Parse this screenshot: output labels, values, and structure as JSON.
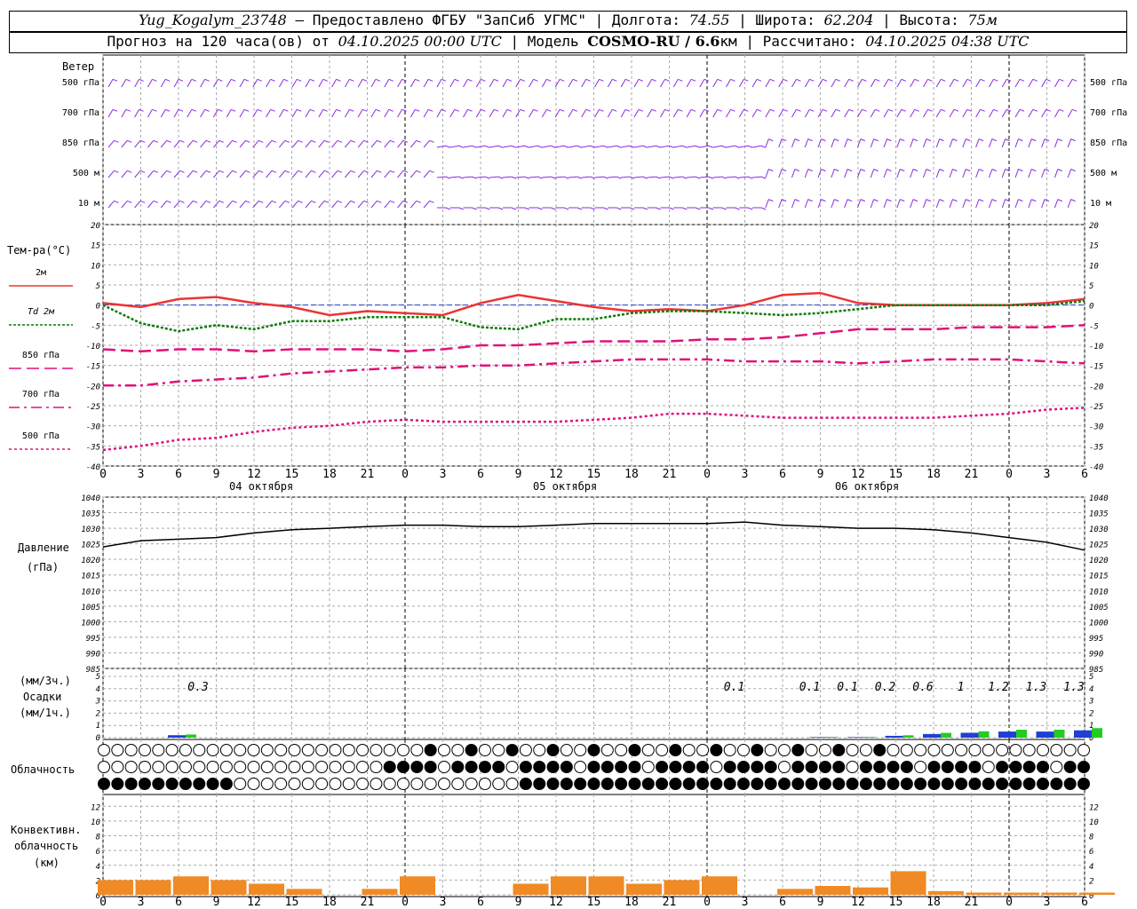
{
  "header": {
    "station": "Yug_Kogalym_23748",
    "dash": "—",
    "provider": "Предоставлено ФГБУ \"ЗапСиб УГМС\"",
    "lon_label": "Долгота:",
    "lon": "74.55",
    "lat_label": "Широта:",
    "lat": "62.204",
    "alt_label": "Высота:",
    "alt": "75м",
    "sep": "|",
    "forecast_prefix": "Прогноз на 120 часа(ов) от",
    "forecast_start": "04.10.2025 00:00 UTC",
    "model_label": "Модель",
    "model": "COSMO-RU / 6.6",
    "model_unit": "км",
    "calc_label": "Рассчитано:",
    "calc_time": "04.10.2025 04:38 UTC"
  },
  "panels": {
    "wind": {
      "title": "Ветер",
      "levels": [
        "500 гПа",
        "700 гПа",
        "850 гПа",
        "500 м",
        "10  м"
      ]
    },
    "temperature": {
      "title": "Тем-ра(°C)",
      "legend": [
        {
          "label": "2м",
          "color": "#ee3333"
        },
        {
          "label": "Td  2м",
          "color": "#0a7a0a"
        },
        {
          "label": "850 гПа",
          "color": "#e0107a"
        },
        {
          "label": "700 гПа",
          "color": "#e0107a"
        },
        {
          "label": "500 гПа",
          "color": "#e0107a"
        }
      ]
    },
    "pressure": {
      "title": "Давление",
      "unit": "(гПа)"
    },
    "precip": {
      "unit_3h": "(мм/3ч.)",
      "title": "Осадки",
      "unit_1h": "(мм/1ч.)"
    },
    "cloud": {
      "title": "Облачность"
    },
    "convective": {
      "title": "Конвективн.",
      "title2": "облачность",
      "unit": "(км)"
    }
  },
  "dates": [
    "04 октября",
    "05 октября",
    "06 октября"
  ],
  "hour_ticks": [
    "0",
    "3",
    "6",
    "9",
    "12",
    "15",
    "18",
    "21",
    "0",
    "3",
    "6",
    "9",
    "12",
    "15",
    "18",
    "21",
    "0",
    "3",
    "6",
    "9",
    "12",
    "15",
    "18",
    "21",
    "0",
    "3",
    "6"
  ],
  "colors": {
    "t2m": "#ee3333",
    "td2m": "#0a7a0a",
    "upper": "#e0107a",
    "wind": "#8a2be2",
    "pressure": "#000000",
    "precip_rain": "#1f3fd6",
    "precip_light": "#22cc22",
    "convective": "#f08a24",
    "zero_line": "#1f3fd6"
  },
  "chart_data": [
    {
      "type": "line",
      "title": "Тем-ра(°C)",
      "x_hours": [
        0,
        3,
        6,
        9,
        12,
        15,
        18,
        21,
        24,
        27,
        30,
        33,
        36,
        39,
        42,
        45,
        48,
        51,
        54,
        57,
        60,
        63,
        66,
        69,
        72,
        75,
        78
      ],
      "ylim": [
        -40,
        20
      ],
      "yticks": [
        -40,
        -35,
        -30,
        -25,
        -20,
        -15,
        -10,
        -5,
        0,
        5,
        10,
        15,
        20
      ],
      "series": [
        {
          "name": "2м",
          "values": [
            0.5,
            -0.5,
            1.5,
            2,
            0.5,
            -0.5,
            -2.5,
            -1.5,
            -2,
            -2.5,
            0.5,
            2.5,
            1,
            -0.5,
            -1.5,
            -1,
            -1.5,
            0,
            2.5,
            3,
            0.5,
            0,
            0,
            0,
            0,
            0.5,
            1.5
          ]
        },
        {
          "name": "Td  2м",
          "values": [
            0,
            -4.5,
            -6.5,
            -5,
            -6,
            -4,
            -4,
            -3,
            -3,
            -3,
            -5.5,
            -6,
            -3.5,
            -3.5,
            -2,
            -1.5,
            -1.5,
            -2,
            -2.5,
            -2,
            -1,
            0,
            0,
            0,
            0,
            0,
            1
          ]
        },
        {
          "name": "850 гПа",
          "values": [
            -11,
            -11.5,
            -11,
            -11,
            -11.5,
            -11,
            -11,
            -11,
            -11.5,
            -11,
            -10,
            -10,
            -9.5,
            -9,
            -9,
            -9,
            -8.5,
            -8.5,
            -8,
            -7,
            -6,
            -6,
            -6,
            -5.5,
            -5.5,
            -5.5,
            -5
          ]
        },
        {
          "name": "700 гПа",
          "values": [
            -20,
            -20,
            -19,
            -18.5,
            -18,
            -17,
            -16.5,
            -16,
            -15.5,
            -15.5,
            -15,
            -15,
            -14.5,
            -14,
            -13.5,
            -13.5,
            -13.5,
            -14,
            -14,
            -14,
            -14.5,
            -14,
            -13.5,
            -13.5,
            -13.5,
            -14,
            -14.5
          ]
        },
        {
          "name": "500 гПа",
          "values": [
            -36,
            -35,
            -33.5,
            -33,
            -31.5,
            -30.5,
            -30,
            -29,
            -28.5,
            -29,
            -29,
            -29,
            -29,
            -28.5,
            -28,
            -27,
            -27,
            -27.5,
            -28,
            -28,
            -28,
            -28,
            -28,
            -27.5,
            -27,
            -26,
            -25.5
          ]
        }
      ]
    },
    {
      "type": "line",
      "title": "Давление",
      "ylabel": "(гПа)",
      "x_hours": [
        0,
        3,
        6,
        9,
        12,
        15,
        18,
        21,
        24,
        27,
        30,
        33,
        36,
        39,
        42,
        45,
        48,
        51,
        54,
        57,
        60,
        63,
        66,
        69,
        72,
        75,
        78
      ],
      "ylim": [
        985,
        1040
      ],
      "yticks": [
        985,
        990,
        995,
        1000,
        1005,
        1010,
        1015,
        1020,
        1025,
        1030,
        1035,
        1040
      ],
      "series": [
        {
          "name": "",
          "values": [
            1024,
            1026,
            1026.5,
            1027,
            1028.5,
            1029.5,
            1030,
            1030.5,
            1031,
            1031,
            1030.5,
            1030.5,
            1031,
            1031.5,
            1031.5,
            1031.5,
            1031.5,
            1032,
            1031,
            1030.5,
            1030,
            1030,
            1029.5,
            1028.5,
            1027,
            1025.5,
            1023
          ]
        }
      ]
    },
    {
      "type": "bar",
      "title": "Осадки",
      "ylim": [
        0,
        5
      ],
      "yticks": [
        0,
        1,
        2,
        3,
        4,
        5
      ],
      "x_hours": [
        0,
        3,
        6,
        9,
        12,
        15,
        18,
        21,
        24,
        27,
        30,
        33,
        36,
        39,
        42,
        45,
        48,
        51,
        54,
        57,
        60,
        63,
        66,
        69,
        72,
        75,
        78
      ],
      "series": [
        {
          "name": "(мм/1ч.)",
          "values": [
            0,
            0,
            0.2,
            0,
            0,
            0,
            0,
            0,
            0,
            0,
            0,
            0,
            0,
            0,
            0,
            0,
            0,
            0,
            0,
            0.05,
            0.05,
            0.15,
            0.3,
            0.4,
            0.5,
            0.5,
            0.6
          ]
        }
      ],
      "annotations": [
        "0.3",
        "0.1",
        "0.1",
        "0.1",
        "0.2",
        "0.6",
        "1",
        "1.2",
        "1.3",
        "1.3"
      ]
    },
    {
      "type": "bar",
      "title": "Конвективн. облачность",
      "ylabel": "(км)",
      "ylim": [
        0,
        13
      ],
      "yticks": [
        0,
        2,
        4,
        6,
        8,
        10,
        12
      ],
      "x_hours": [
        0,
        3,
        6,
        9,
        12,
        15,
        18,
        21,
        24,
        27,
        30,
        33,
        36,
        39,
        42,
        45,
        48,
        51,
        54,
        57,
        60,
        63,
        66,
        69,
        72,
        75,
        78
      ],
      "values": [
        2,
        2,
        2.5,
        2,
        1.5,
        0.8,
        0,
        0.8,
        2.5,
        0,
        0,
        1.5,
        2.5,
        2.5,
        1.5,
        2,
        2.5,
        0,
        0.8,
        1.2,
        1,
        3.2,
        0.5,
        0.3,
        0.3,
        0.3,
        0.3
      ]
    }
  ]
}
